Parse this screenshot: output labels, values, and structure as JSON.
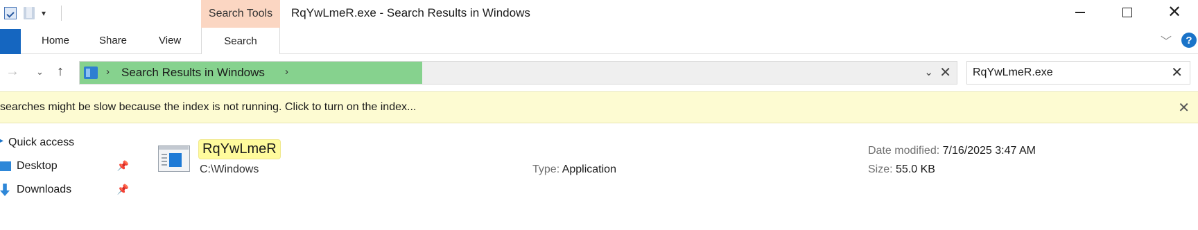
{
  "window": {
    "title": "RqYwLmeR.exe - Search Results in Windows",
    "context_tab": "Search Tools",
    "controls": {
      "minimize": "",
      "maximize": "",
      "close": "✕"
    }
  },
  "ribbon": {
    "tabs": [
      "Home",
      "Share",
      "View",
      "Search"
    ],
    "help": "?"
  },
  "address": {
    "location": "Search Results in Windows",
    "separator": "›"
  },
  "search": {
    "value": "RqYwLmeR.exe",
    "placeholder": ""
  },
  "info_bar": {
    "message": "searches might be slow because the index is not running.  Click to turn on the index...",
    "close": "✕"
  },
  "nav_pane": {
    "items": [
      "Quick access",
      "Desktop",
      "Downloads"
    ]
  },
  "result": {
    "name": "RqYwLmeR",
    "path": "C:\\Windows",
    "type_label": "Type:",
    "type_value": "Application",
    "date_label": "Date modified:",
    "date_value": "7/16/2025 3:47 AM",
    "size_label": "Size:",
    "size_value": "55.0 KB"
  },
  "colors": {
    "context_tab": "#fbd6c2",
    "address_highlight": "#86d28e",
    "info_bar": "#fdfbd2",
    "name_highlight": "#fffb9c",
    "accent": "#1566c0"
  },
  "icons": [
    "properties-icon",
    "new-folder-icon",
    "dropdown-icon",
    "back-arrow-icon",
    "recent-dropdown-icon",
    "up-arrow-icon",
    "folder-icon",
    "chevron-right-icon",
    "dropdown-chevron-icon",
    "clear-icon",
    "help-icon",
    "pin-icon",
    "application-icon"
  ]
}
